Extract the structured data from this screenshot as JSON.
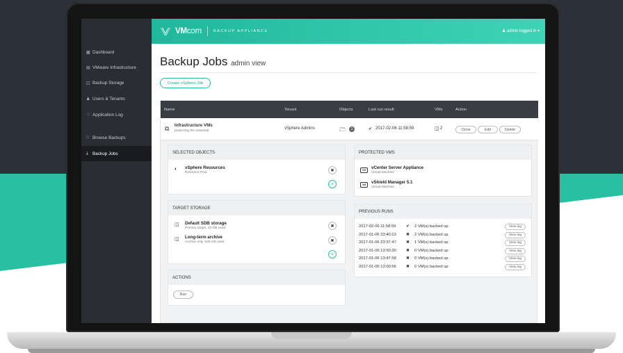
{
  "app": {
    "brand": "VMcom",
    "brand_prefix": "VM",
    "brand_suffix": "com",
    "subtitle": "BACKUP APPLIANCE",
    "user_menu": "admin logged in",
    "accent": "#27c0a3"
  },
  "sidebar": {
    "items": [
      {
        "label": "Dashboard",
        "icon": "dashboard-icon"
      },
      {
        "label": "VMware Infrastructure",
        "icon": "list-icon"
      },
      {
        "label": "Backup Storage",
        "icon": "storage-icon"
      },
      {
        "label": "Users & Tenants",
        "icon": "users-icon"
      },
      {
        "label": "Application Log",
        "icon": "heart-icon"
      },
      {
        "label": "Browse Backups",
        "icon": "browse-icon"
      },
      {
        "label": "Backup Jobs",
        "icon": "download-icon"
      }
    ],
    "active": "Backup Jobs"
  },
  "page": {
    "title": "Backup Jobs",
    "subtitle": "admin view",
    "create_button": "Create vSphere Job"
  },
  "table": {
    "columns": [
      "Name",
      "Tenant",
      "Objects",
      "Last run result",
      "VMs",
      "Action"
    ],
    "job": {
      "name": "Infrastructure VMs",
      "description": "protecting the essential",
      "tenant": "vSphere Admins",
      "objects_count": "1",
      "last_run": "2017-02-06 11:58:59",
      "vms": "2",
      "actions": [
        "Close",
        "Edit",
        "Delete"
      ]
    }
  },
  "selected_objects": {
    "heading": "SELECTED OBJECTS",
    "items": [
      {
        "name": "vSphere Resources",
        "type": "Resource Pool"
      }
    ]
  },
  "target_storage": {
    "heading": "TARGET STORAGE",
    "items": [
      {
        "name": "Default SDB storage",
        "detail": "Primary target, 42 GB used"
      },
      {
        "name": "Long-term archive",
        "detail": "Archive only, 525 GB used"
      }
    ]
  },
  "actions_box": {
    "heading": "ACTIONS",
    "run_button": "Run"
  },
  "protected_vms": {
    "heading": "PROTECTED VMS",
    "items": [
      {
        "name": "vCenter Server Appliance",
        "type": "Virtual Machine",
        "badge": "VM"
      },
      {
        "name": "vShield Manager 5.1",
        "type": "Virtual Machine",
        "badge": "VM"
      }
    ]
  },
  "previous_runs": {
    "heading": "PREVIOUS RUNS",
    "view_log": "View log",
    "runs": [
      {
        "time": "2017-02-06 11:58:59",
        "ok": true,
        "result": "2 VM(s) backed up"
      },
      {
        "time": "2017-01-06 23:40:13",
        "ok": false,
        "result": "2 VM(s) backed up"
      },
      {
        "time": "2017-01-06 23:37:47",
        "ok": false,
        "result": "1 VM(s) backed up"
      },
      {
        "time": "2017-01-06 13:50:30",
        "ok": false,
        "result": "0 VM(s) backed up"
      },
      {
        "time": "2017-01-06 13:47:58",
        "ok": false,
        "result": "0 VM(s) backed up"
      },
      {
        "time": "2017-01-06 13:00:56",
        "ok": false,
        "result": "0 VM(s) backed up"
      }
    ]
  }
}
